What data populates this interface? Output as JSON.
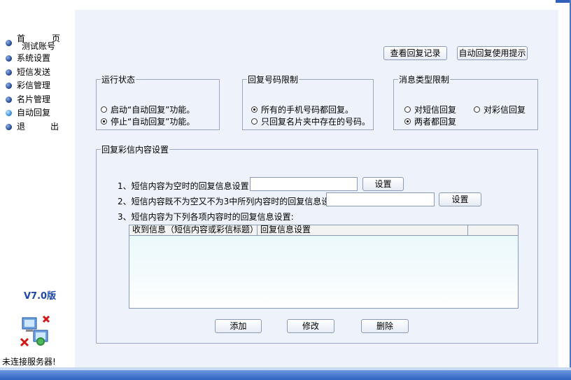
{
  "sidebar": {
    "home_part1": "首",
    "home_part2": "页",
    "account": "测试账号",
    "items": [
      {
        "label": "系统设置"
      },
      {
        "label": "短信发送"
      },
      {
        "label": "彩信管理"
      },
      {
        "label": "名片管理"
      },
      {
        "label": "自动回复",
        "active": true
      }
    ],
    "exit_part1": "退",
    "exit_part2": "出",
    "version": "V7.0版",
    "server_status": "未连接服务器!"
  },
  "toolbar": {
    "view_records": "查看回复记录",
    "usage_tips": "自动回复使用提示"
  },
  "run_state": {
    "legend": "运行状态",
    "options": [
      {
        "label": "启动“自动回复”功能。",
        "checked": false
      },
      {
        "label": "停止“自动回复”功能。",
        "checked": true
      }
    ]
  },
  "number_limit": {
    "legend": "回复号码限制",
    "options": [
      {
        "label": "所有的手机号码都回复。",
        "checked": true
      },
      {
        "label": "只回复名片夹中存在的号码。",
        "checked": false
      }
    ]
  },
  "msg_type": {
    "legend": "消息类型限制",
    "options": [
      {
        "label": "对短信回复",
        "checked": false
      },
      {
        "label": "对彩信回复",
        "checked": false
      },
      {
        "label": "两者都回复",
        "checked": true
      }
    ]
  },
  "content": {
    "legend": "回复彩信内容设置",
    "line1": "1、短信内容为空时的回复信息设置:",
    "line2": "2、短信内容既不为空又不为3中所列内容时的回复信息设置:",
    "line3": "3、短信内容为下列各项内容时的回复信息设置:",
    "set_button": "设置",
    "input1_value": "",
    "input2_value": "",
    "columns": [
      "收到信息（短信内容或彩信标题）",
      "回复信息设置",
      ""
    ],
    "add": "添加",
    "modify": "修改",
    "delete": "删除"
  }
}
